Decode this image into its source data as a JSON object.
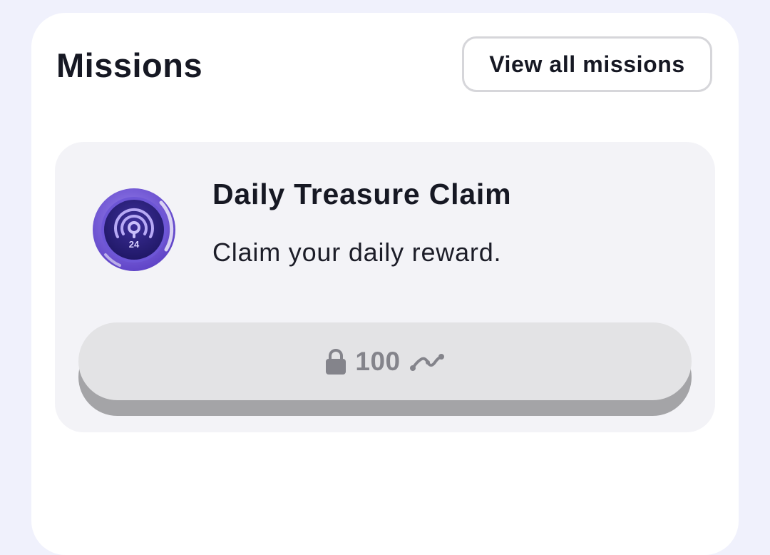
{
  "header": {
    "title": "Missions",
    "view_all_label": "View all missions"
  },
  "mission": {
    "title": "Daily Treasure Claim",
    "description": "Claim your daily reward.",
    "icon": "broadcast-24-badge-icon",
    "icon_number": "24",
    "reward": {
      "amount": "100",
      "locked": true,
      "lock_icon": "lock-icon",
      "unit_icon": "points-squiggle-icon"
    }
  },
  "colors": {
    "page_background": "#f0f1fc",
    "panel_background": "#ffffff",
    "card_background": "#f3f3f7",
    "button_face": "#e3e3e5",
    "button_shadow": "#a4a4a7",
    "badge_purple": "#5b3fc4",
    "text_primary": "#161823",
    "text_muted": "#84848b"
  }
}
